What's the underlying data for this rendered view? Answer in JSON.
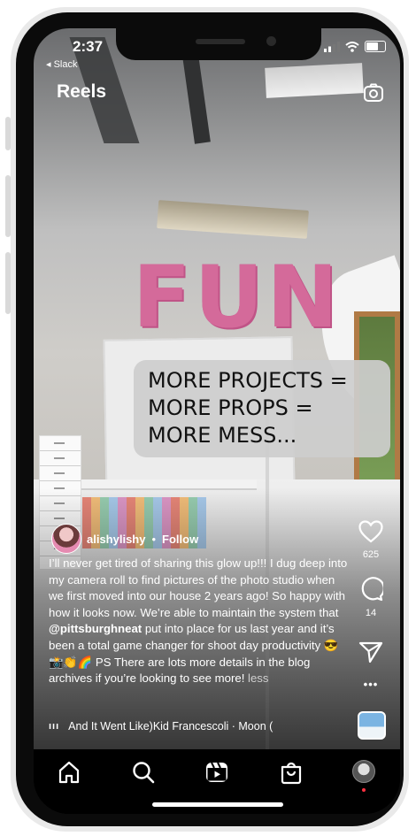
{
  "status_bar": {
    "time": "2:37",
    "back_app": "◂ Slack"
  },
  "header": {
    "title": "Reels",
    "camera_icon": "camera-icon"
  },
  "reel": {
    "overlay_lines": [
      "MORE PROJECTS =",
      "MORE PROPS =",
      "MORE MESS..."
    ],
    "wall_sign": "FUN",
    "author": {
      "username": "alishylishy",
      "separator": "•",
      "follow_label": "Follow"
    },
    "caption": {
      "text_before": "I’ll never get tired of sharing this glow up!!! I dug deep into my camera roll to find pictures of the photo studio when we first moved into our house 2 years ago! So happy with how it looks now. We’re able to maintain the system that ",
      "mention": "@pittsburghneat",
      "text_after": " put into place for us last year and it’s been a total game changer for shoot day productivity 😎📸👏🌈 PS There are lots more details in the blog archives if you’re looking to see more! ",
      "less_label": "less"
    },
    "music": {
      "label": "And It Went Like)Kid Francescoli · Moon ("
    },
    "actions": {
      "likes": "625",
      "comments": "14",
      "more": "•••"
    }
  },
  "bottom_nav": {
    "items": [
      "home-icon",
      "search-icon",
      "reels-icon",
      "shop-icon",
      "profile-avatar"
    ]
  },
  "colors": {
    "overlay_bg": "#cdcdcd",
    "sign": "#d46a9a",
    "notification": "#ff3040"
  }
}
